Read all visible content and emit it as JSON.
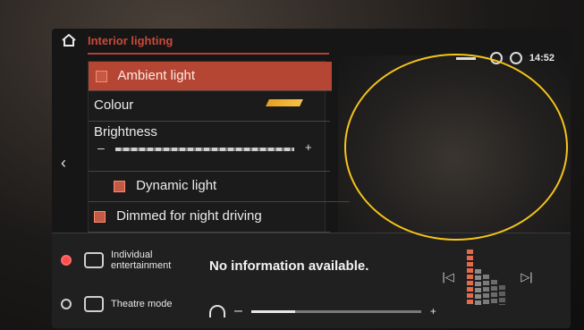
{
  "header": {
    "breadcrumb": "Interior lighting",
    "time": "14:52"
  },
  "menu": {
    "ambient_light": "Ambient light",
    "colour": "Colour",
    "brightness": "Brightness",
    "dynamic_light": "Dynamic light",
    "dimmed": "Dimmed for night driving",
    "brightness_min": "–",
    "brightness_max": "+"
  },
  "bottom": {
    "no_info": "No information available.",
    "sources": [
      {
        "label": "Individual entertainment",
        "selected": true
      },
      {
        "label": "Theatre mode",
        "selected": false
      }
    ],
    "volume_level": 0.26,
    "volume_min": "–",
    "volume_max": "+"
  },
  "colors": {
    "accent": "#b54633",
    "highlight_circle": "#f5c518",
    "ambient_swatch": "#e8a020"
  },
  "icons": {
    "home": "home-icon",
    "back": "chevron-left-icon",
    "prev": "skip-previous-icon",
    "next": "skip-next-icon",
    "headphones": "headphones-icon"
  }
}
